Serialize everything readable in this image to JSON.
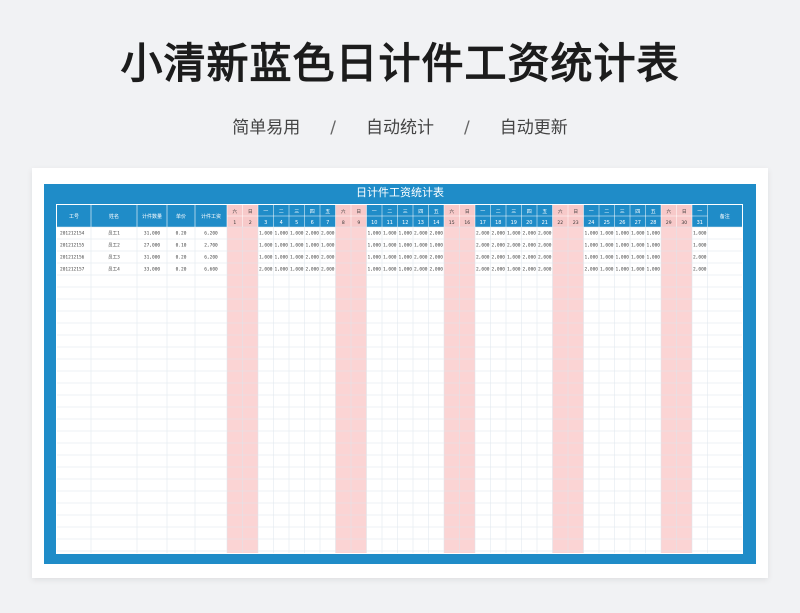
{
  "page": {
    "title": "小清新蓝色日计件工资统计表",
    "subtitle": [
      "简单易用",
      "自动统计",
      "自动更新"
    ],
    "separator": "/"
  },
  "sheet": {
    "title": "日计件工资统计表",
    "columns": [
      "工号",
      "姓名",
      "计件数量",
      "单价",
      "计件工资"
    ],
    "remark_header": "备注",
    "weekday_labels": [
      "六",
      "日",
      "一",
      "二",
      "三",
      "四",
      "五",
      "六",
      "日",
      "一",
      "二",
      "三",
      "四",
      "五",
      "六",
      "日",
      "一",
      "二",
      "三",
      "四",
      "五",
      "六",
      "日",
      "一",
      "二",
      "三",
      "四",
      "五",
      "六",
      "日",
      "一"
    ],
    "day_numbers": [
      "1",
      "2",
      "3",
      "4",
      "5",
      "6",
      "7",
      "8",
      "9",
      "10",
      "11",
      "12",
      "13",
      "14",
      "15",
      "16",
      "17",
      "18",
      "19",
      "20",
      "21",
      "22",
      "23",
      "24",
      "25",
      "26",
      "27",
      "28",
      "29",
      "30",
      "31"
    ],
    "rows": [
      {
        "id": "201212154",
        "name": "员工1",
        "qty": "31,000",
        "price": "0.20",
        "wage": "6,200",
        "days": [
          "",
          "",
          "1,000",
          "1,000",
          "1,000",
          "2,000",
          "2,000",
          "",
          "",
          "1,000",
          "1,000",
          "1,000",
          "2,000",
          "2,000",
          "",
          "",
          "2,000",
          "2,000",
          "1,000",
          "2,000",
          "2,000",
          "",
          "",
          "1,000",
          "1,000",
          "1,000",
          "1,000",
          "1,000",
          "",
          "",
          "1,000"
        ]
      },
      {
        "id": "201212155",
        "name": "员工2",
        "qty": "27,000",
        "price": "0.10",
        "wage": "2,700",
        "days": [
          "",
          "",
          "1,000",
          "1,000",
          "1,000",
          "1,000",
          "1,000",
          "",
          "",
          "1,000",
          "1,000",
          "1,000",
          "1,000",
          "1,000",
          "",
          "",
          "2,000",
          "2,000",
          "2,000",
          "2,000",
          "2,000",
          "",
          "",
          "1,000",
          "1,000",
          "1,000",
          "1,000",
          "1,000",
          "",
          "",
          "1,000"
        ]
      },
      {
        "id": "201212156",
        "name": "员工3",
        "qty": "31,000",
        "price": "0.20",
        "wage": "6,200",
        "days": [
          "",
          "",
          "1,000",
          "1,000",
          "1,000",
          "2,000",
          "2,000",
          "",
          "",
          "1,000",
          "1,000",
          "1,000",
          "2,000",
          "2,000",
          "",
          "",
          "2,000",
          "2,000",
          "1,000",
          "2,000",
          "2,000",
          "",
          "",
          "1,000",
          "1,000",
          "1,000",
          "1,000",
          "1,000",
          "",
          "",
          "2,000"
        ]
      },
      {
        "id": "201212157",
        "name": "员工4",
        "qty": "33,000",
        "price": "0.20",
        "wage": "6,600",
        "days": [
          "",
          "",
          "2,000",
          "1,000",
          "1,000",
          "2,000",
          "2,000",
          "",
          "",
          "1,000",
          "1,000",
          "1,000",
          "2,000",
          "2,000",
          "",
          "",
          "2,000",
          "2,000",
          "1,000",
          "2,000",
          "2,000",
          "",
          "",
          "2,000",
          "1,000",
          "1,000",
          "1,000",
          "1,000",
          "",
          "",
          "2,000"
        ]
      }
    ],
    "empty_rows": 27
  },
  "colors": {
    "header_blue": "#1f8cc8",
    "weekend_pink": "#fbd4d4",
    "weekend_header_pink": "#f7c9c9",
    "grid_line": "#dde5ec"
  }
}
